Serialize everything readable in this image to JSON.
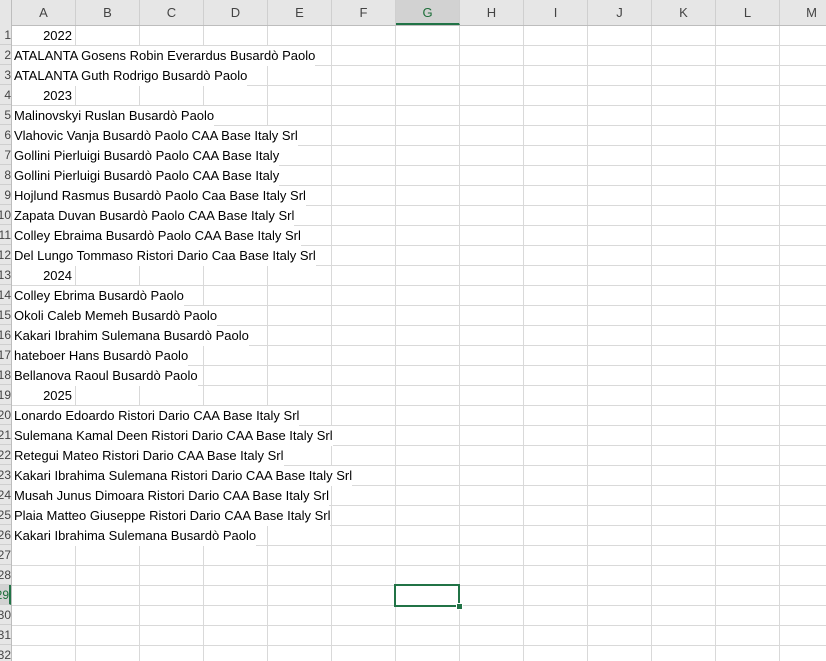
{
  "columns": [
    "A",
    "B",
    "C",
    "D",
    "E",
    "F",
    "G",
    "H",
    "I",
    "J",
    "K",
    "L",
    "M"
  ],
  "selected_column": "G",
  "rows": [
    {
      "label": "1",
      "text": "2022",
      "year": true
    },
    {
      "label": "2",
      "text": "ATALANTA Gosens Robin Everardus Busardò Paolo"
    },
    {
      "label": "3",
      "text": "ATALANTA Guth Rodrigo Busardò Paolo"
    },
    {
      "label": "4",
      "text": "2023",
      "year": true
    },
    {
      "label": "5",
      "text": "Malinovskyi Ruslan Busardò  Paolo"
    },
    {
      "label": "6",
      "text": "Vlahovic Vanja Busardò Paolo CAA Base Italy Srl"
    },
    {
      "label": "7",
      "text": "Gollini Pierluigi Busardò Paolo CAA Base Italy"
    },
    {
      "label": "8",
      "text": "Gollini Pierluigi Busardò Paolo CAA Base Italy"
    },
    {
      "label": "9",
      "text": "Hojlund Rasmus Busardò Paolo Caa Base Italy Srl"
    },
    {
      "label": "10",
      "text": "Zapata Duvan Busardò Paolo CAA Base Italy Srl"
    },
    {
      "label": "11",
      "text": "Colley Ebraima Busardò Paolo CAA Base Italy Srl"
    },
    {
      "label": "12",
      "text": "Del Lungo  Tommaso Ristori Dario Caa Base Italy Srl"
    },
    {
      "label": "13",
      "text": "2024",
      "year": true
    },
    {
      "label": "14",
      "text": "Colley Ebrima Busardò Paolo"
    },
    {
      "label": "15",
      "text": "Okoli Caleb Memeh Busardò Paolo"
    },
    {
      "label": "16",
      "text": "Kakari Ibrahim Sulemana Busardò Paolo"
    },
    {
      "label": "17",
      "text": "hateboer Hans Busardò Paolo"
    },
    {
      "label": "18",
      "text": "Bellanova Raoul Busardò Paolo"
    },
    {
      "label": "19",
      "text": "2025",
      "year": true
    },
    {
      "label": "20",
      "text": "Lonardo Edoardo Ristori Dario CAA Base Italy Srl"
    },
    {
      "label": "21",
      "text": "Sulemana Kamal Deen Ristori  Dario CAA Base Italy Srl"
    },
    {
      "label": "22",
      "text": "Retegui Mateo Ristori Dario CAA Base Italy Srl"
    },
    {
      "label": "23",
      "text": "Kakari Ibrahima Sulemana Ristori Dario CAA Base Italy Srl"
    },
    {
      "label": "24",
      "text": "Musah Junus Dimoara Ristori Dario CAA Base Italy Srl"
    },
    {
      "label": "25",
      "text": "Plaia Matteo Giuseppe Ristori Dario CAA Base Italy Srl"
    },
    {
      "label": "26",
      "text": "Kakari Ibrahima Sulemana Busardò Paolo"
    },
    {
      "label": "27",
      "text": ""
    },
    {
      "label": "28",
      "text": ""
    },
    {
      "label": "29",
      "text": ""
    },
    {
      "label": "30",
      "text": ""
    },
    {
      "label": "31",
      "text": ""
    },
    {
      "label": "32",
      "text": ""
    }
  ],
  "selected_row": "29",
  "colors": {
    "accent": "#217346",
    "grid": "#d9d9d9",
    "header_bg": "#e6e6e6"
  }
}
